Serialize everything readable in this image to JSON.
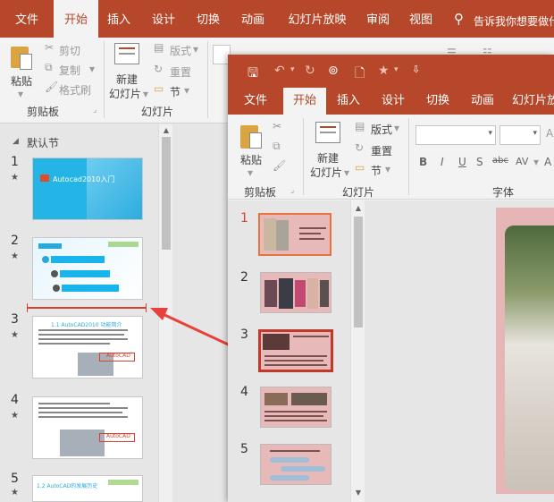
{
  "back": {
    "tabs": [
      "文件",
      "开始",
      "插入",
      "设计",
      "切换",
      "动画",
      "幻灯片放映",
      "审阅",
      "视图"
    ],
    "active_tab": "开始",
    "tell_me": "告诉我你想要做什么",
    "clipboard": {
      "paste": "粘贴",
      "cut": "剪切",
      "copy": "复制",
      "format_painter": "格式刷",
      "group": "剪贴板"
    },
    "slides": {
      "new_slide_1": "新建",
      "new_slide_2": "幻灯片",
      "layout": "版式",
      "reset": "重置",
      "section": "节",
      "group": "幻灯片"
    },
    "section_name": "默认节",
    "slide_numbers": [
      "1",
      "2",
      "3",
      "4",
      "5"
    ],
    "thumbs": {
      "s1_title": "Autocad2010入门",
      "s3_title": "1.1 AutoCAD2010 功能简介",
      "s3_badge": "AutoCAD",
      "s4_badge": "AutoCAD",
      "s5_title": "1.2 AutoCAD的发展历史"
    }
  },
  "front": {
    "tabs": [
      "文件",
      "开始",
      "插入",
      "设计",
      "切换",
      "动画",
      "幻灯片放"
    ],
    "active_tab": "开始",
    "clipboard": {
      "paste": "粘贴",
      "group": "剪贴板"
    },
    "slides": {
      "new_slide_1": "新建",
      "new_slide_2": "幻灯片",
      "layout": "版式",
      "reset": "重置",
      "section": "节",
      "group": "幻灯片"
    },
    "font_group": "字体",
    "format_buttons": [
      "B",
      "I",
      "U",
      "S",
      "abc",
      "AV"
    ],
    "slide_numbers": [
      "1",
      "2",
      "3",
      "4",
      "5"
    ]
  },
  "colors": {
    "accent": "#b7472a",
    "selection_orange": "#e8733f",
    "selection_red": "#c0392b",
    "arrow": "#e8413c"
  }
}
